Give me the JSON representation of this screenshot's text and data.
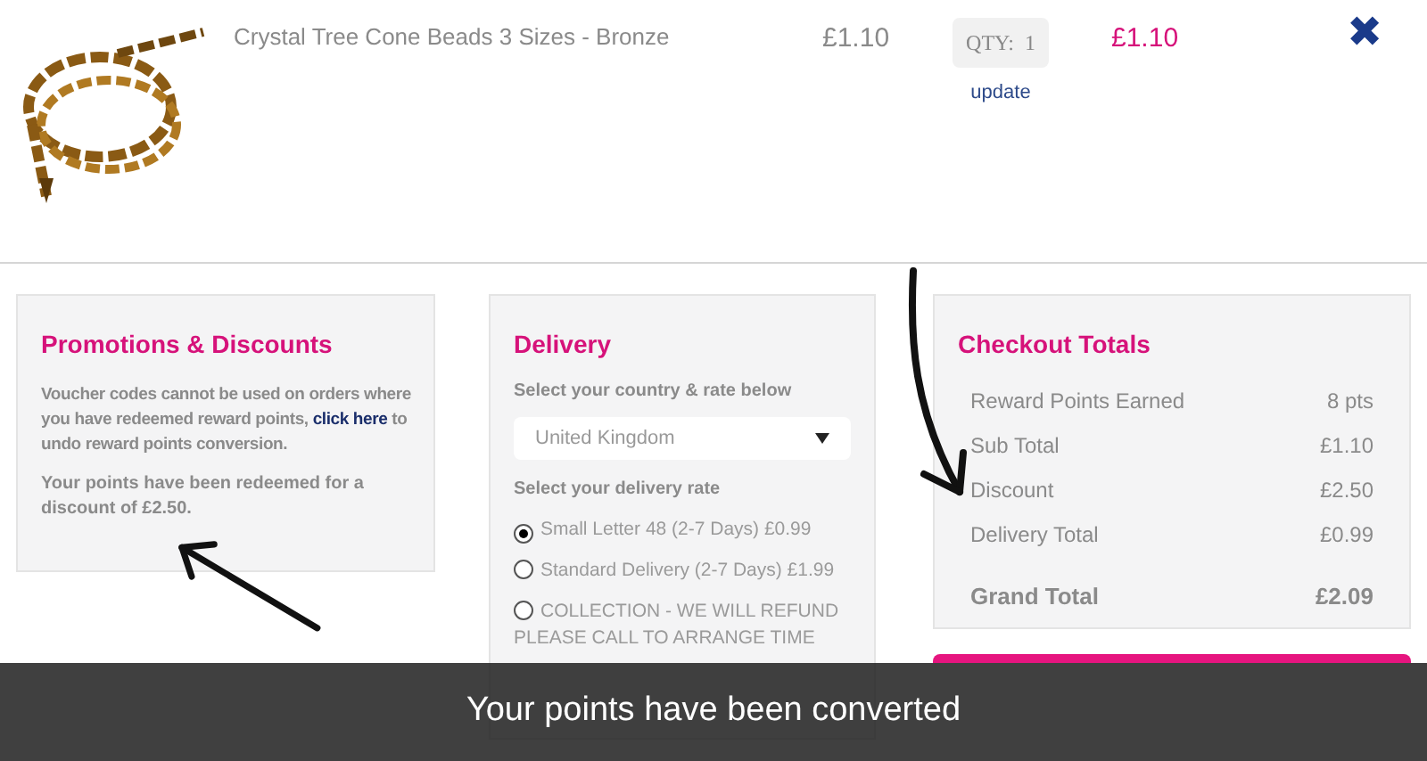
{
  "cart_item": {
    "name": "Crystal Tree Cone Beads 3 Sizes - Bronze",
    "price": "£1.10",
    "quantity": "QTY:  1",
    "update_link": "update",
    "line_total": "£1.10",
    "remove": "✖"
  },
  "promotions": {
    "title": "Promotions & Discounts",
    "notice": "Voucher codes cannot be used on orders where you have redeemed reward points,",
    "link": "click here",
    "notice_end": "to undo reward points conversion.",
    "redeemed": "Your points have been redeemed for a discount of £2.50."
  },
  "delivery": {
    "title": "Delivery",
    "country_label": "Select your country & rate below",
    "country": "United Kingdom",
    "rate_label": "Select your delivery rate",
    "rates": [
      {
        "label": "Small Letter 48 (2-7 Days) £0.99",
        "selected": true
      },
      {
        "label": "Standard Delivery (2-7 Days) £1.99",
        "selected": false
      },
      {
        "label": "COLLECTION - WE WILL REFUND PLEASE CALL TO ARRANGE TIME",
        "selected": false
      }
    ]
  },
  "totals": {
    "title": "Checkout Totals",
    "rows": [
      {
        "label": "Reward Points Earned",
        "value": "8 pts"
      },
      {
        "label": "Sub Total",
        "value": "£1.10"
      },
      {
        "label": "Discount",
        "value": "£2.50"
      },
      {
        "label": "Delivery Total",
        "value": "£0.99"
      }
    ],
    "grand_label": "Grand Total",
    "grand_value": "£2.09"
  },
  "caption": "Your points have been converted"
}
